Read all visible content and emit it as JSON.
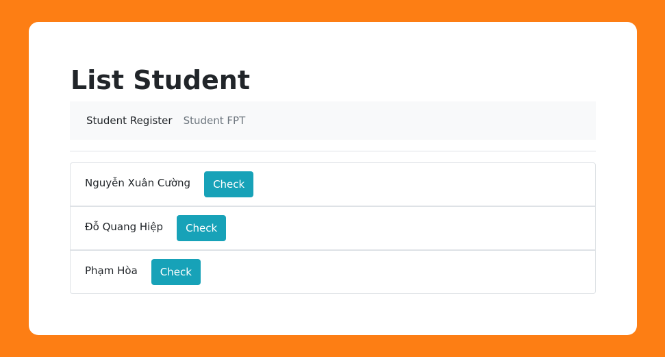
{
  "page": {
    "title": "List Student"
  },
  "navbar": {
    "brand": "Student Register",
    "link": "Student FPT"
  },
  "students": [
    {
      "name": "Nguyễn Xuân Cường",
      "button_label": "Check"
    },
    {
      "name": "Đỗ Quang Hiệp",
      "button_label": "Check"
    },
    {
      "name": "Phạm Hòa",
      "button_label": "Check"
    }
  ],
  "colors": {
    "background": "#fd7e14",
    "button": "#17a2b8",
    "navbar": "#f8f9fa"
  }
}
